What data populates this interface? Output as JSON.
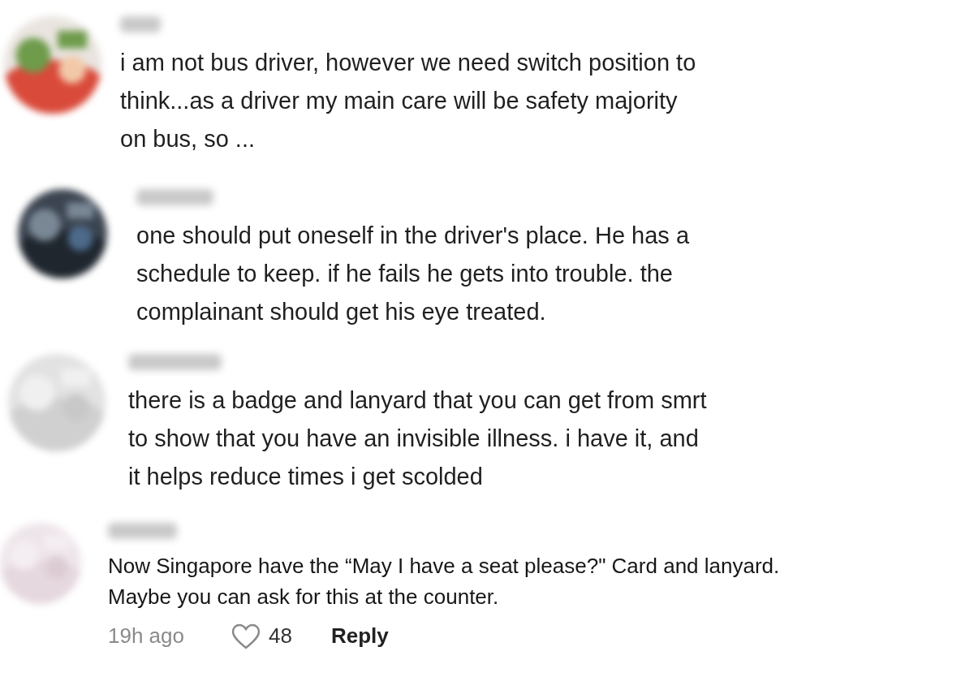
{
  "comments": [
    {
      "text": "i am not bus driver, however we need switch position to\nthink...as a driver my main care will be safety majority\non bus, so ..."
    },
    {
      "text": "one should put oneself in the driver's place. He has a\nschedule to keep. if he fails he gets into trouble. the\ncomplainant should get his eye treated."
    },
    {
      "text": "there is a badge and lanyard that you can get from smrt\nto show that you have an invisible illness. i have it, and\nit helps reduce times i get scolded"
    },
    {
      "text": "Now Singapore have the “May I have a seat please?\" Card and lanyard.\nMaybe you can ask for this at the counter.",
      "footer": {
        "time": "19h ago",
        "likes": "48",
        "liked": false,
        "reply": "Reply"
      }
    }
  ]
}
